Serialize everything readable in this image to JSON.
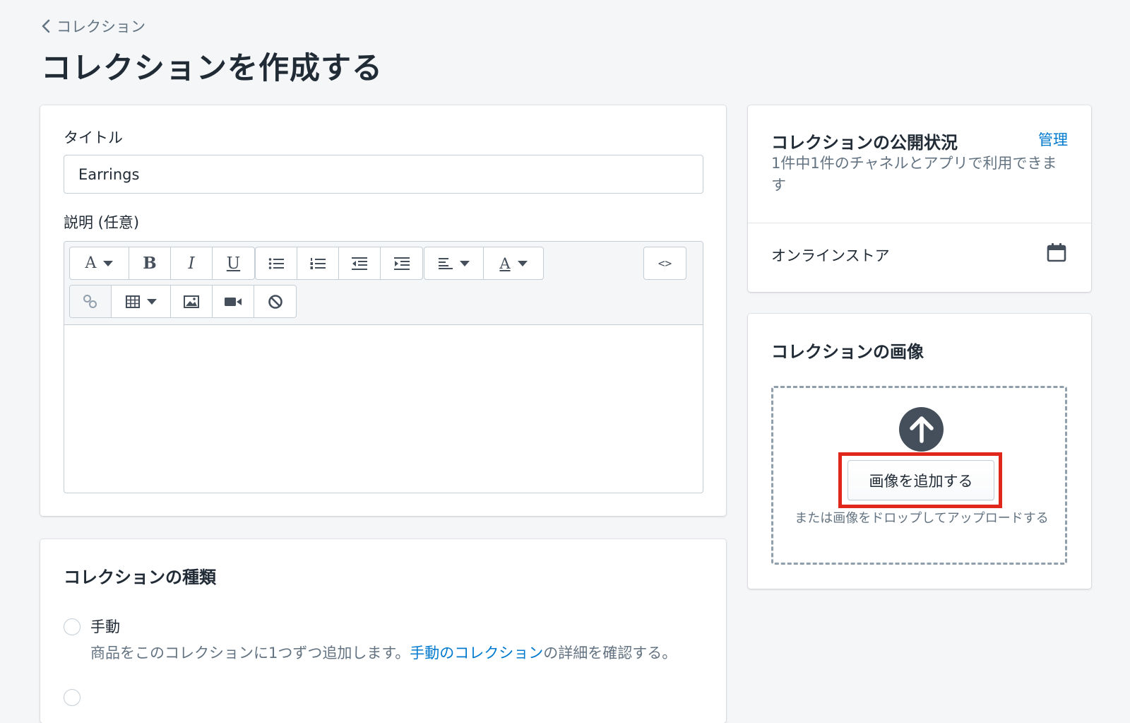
{
  "breadcrumb": {
    "label": "コレクション"
  },
  "page": {
    "title": "コレクションを作成する"
  },
  "main_card": {
    "title_label": "タイトル",
    "title_value": "Earrings",
    "description_label": "説明 (任意)",
    "toolbar_icons": [
      "font-icon",
      "bold-icon",
      "italic-icon",
      "underline-icon",
      "bullet-list-icon",
      "numbered-list-icon",
      "outdent-icon",
      "indent-icon",
      "align-icon",
      "text-color-icon",
      "code-icon",
      "link-icon",
      "table-icon",
      "image-icon",
      "video-icon",
      "clear-formatting-icon"
    ]
  },
  "collection_type": {
    "title": "コレクションの種類",
    "manual_label": "手動",
    "manual_help_before": "商品をこのコレクションに1つずつ追加します。",
    "manual_help_link": "手動のコレクション",
    "manual_help_after": "の詳細を確認する。"
  },
  "availability": {
    "title": "コレクションの公開状況",
    "manage_link": "管理",
    "subtitle": "1件中1件のチャネルとアプリで利用できます",
    "channel": "オンラインストア"
  },
  "collection_image": {
    "title": "コレクションの画像",
    "add_button": "画像を追加する",
    "drop_hint": "または画像をドロップしてアップロードする"
  },
  "colors": {
    "link": "#007ace",
    "highlight": "#e1261c",
    "text": "#212b36",
    "subdued": "#637381"
  }
}
